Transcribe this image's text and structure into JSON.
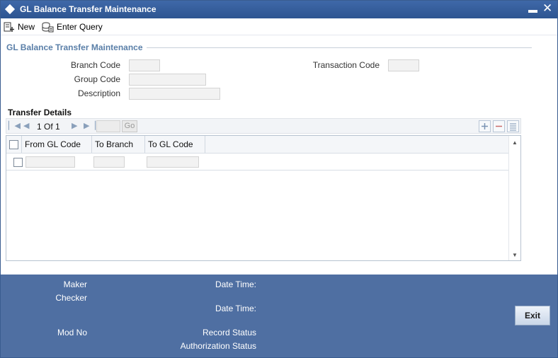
{
  "window": {
    "title": "GL Balance Transfer Maintenance"
  },
  "toolbar": {
    "new_label": "New",
    "enter_query_label": "Enter Query"
  },
  "form": {
    "section_title": "GL Balance Transfer Maintenance",
    "branch_code_label": "Branch Code",
    "branch_code_value": "",
    "transaction_code_label": "Transaction Code",
    "transaction_code_value": "",
    "group_code_label": "Group Code",
    "group_code_value": "",
    "description_label": "Description",
    "description_value": ""
  },
  "transfer_details": {
    "title": "Transfer Details",
    "pagination": {
      "text": "1 Of 1",
      "go_label": "Go"
    },
    "columns": [
      "From GL Code",
      "To Branch",
      "To GL Code"
    ],
    "rows": [
      {
        "from_gl_code": "",
        "to_branch": "",
        "to_gl_code": ""
      }
    ]
  },
  "footer": {
    "maker_label": "Maker",
    "checker_label": "Checker",
    "date_time_label_1": "Date Time:",
    "date_time_label_2": "Date Time:",
    "mod_no_label": "Mod No",
    "record_status_label": "Record Status",
    "authorization_status_label": "Authorization Status",
    "exit_label": "Exit"
  },
  "colors": {
    "title_bar": "#2d5591",
    "footer": "#4f6fa2",
    "section_title": "#5a7fa8"
  }
}
